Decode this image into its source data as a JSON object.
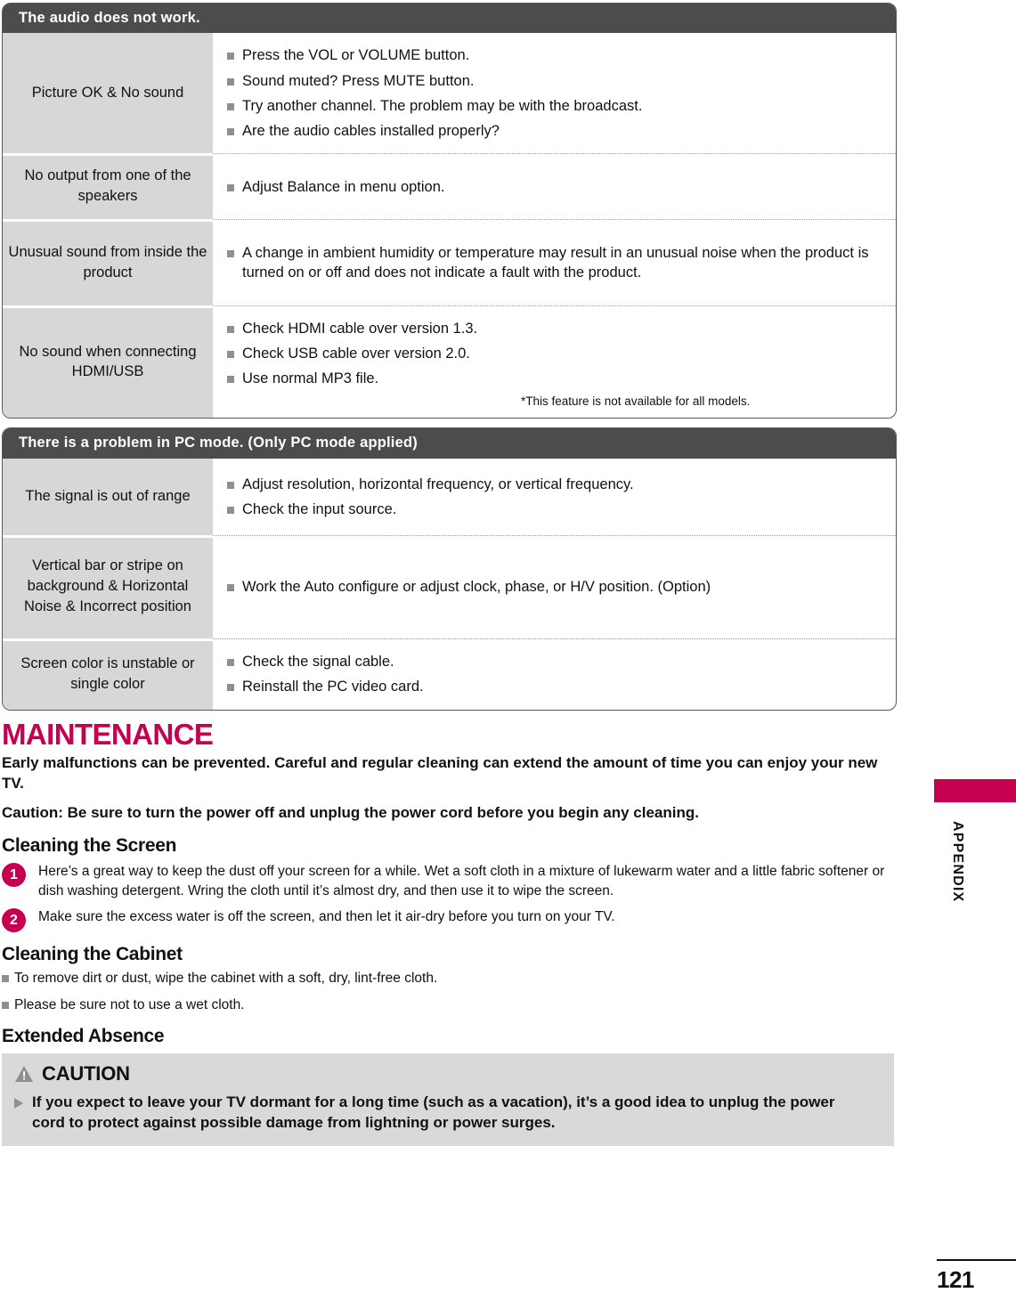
{
  "colors": {
    "accent": "#C6004F",
    "header_bar": "#4C4C4C",
    "label_cell": "#D7D7D7",
    "caution_bg": "#D9D9D9",
    "bullet": "#8F8F8F"
  },
  "tables": [
    {
      "header": "The audio does not work.",
      "rows": [
        {
          "label": "Picture OK & No sound",
          "items": [
            "Press the VOL or VOLUME button.",
            "Sound muted? Press MUTE button.",
            "Try another channel. The problem may be with the broadcast.",
            "Are the audio cables installed properly?"
          ]
        },
        {
          "label": "No output from one of the speakers",
          "items": [
            "Adjust Balance in menu option."
          ]
        },
        {
          "label": "Unusual sound from inside the product",
          "items": [
            "A change in ambient humidity or temperature may result in an unusual noise when the product is turned on or off and does not indicate a fault with the product."
          ]
        },
        {
          "label": "No sound when connecting HDMI/USB",
          "items": [
            "Check HDMI cable over version 1.3.",
            "Check USB cable over version 2.0.",
            "Use normal MP3 file."
          ],
          "note": "*This feature is not available for all models."
        }
      ]
    },
    {
      "header": "There is a problem in PC mode. (Only PC mode applied)",
      "rows": [
        {
          "label": "The signal is out of range",
          "items": [
            "Adjust resolution, horizontal frequency, or vertical frequency.",
            "Check the input source."
          ]
        },
        {
          "label": "Vertical bar or stripe on background & Horizontal Noise & Incorrect position",
          "items": [
            "Work the Auto configure or adjust clock, phase, or H/V position. (Option)"
          ]
        },
        {
          "label": "Screen color is unstable or single color",
          "items": [
            "Check the signal cable.",
            "Reinstall the PC video card."
          ]
        }
      ]
    }
  ],
  "maintenance": {
    "title": "MAINTENANCE",
    "intro": "Early malfunctions can be prevented. Careful and regular cleaning can extend the amount of time you can enjoy your new TV.",
    "caution_line": "Caution: Be sure to turn the power off and unplug the power cord before you begin any cleaning.",
    "cleaning_screen": {
      "title": "Cleaning the Screen",
      "steps": [
        {
          "num": "1",
          "text": "Here’s a great way to keep the dust off your screen for a while. Wet a soft cloth in a mixture of lukewarm water and a little fabric softener or dish washing detergent. Wring the cloth until it’s almost dry, and then use it to wipe the screen."
        },
        {
          "num": "2",
          "text": "Make sure the excess water is off the screen, and then let it air-dry before you turn on your TV."
        }
      ]
    },
    "cleaning_cabinet": {
      "title": "Cleaning the Cabinet",
      "items": [
        "To remove dirt or dust, wipe the cabinet with a soft, dry, lint-free cloth.",
        "Please be sure not to use a wet cloth."
      ]
    },
    "extended_absence": {
      "title": "Extended Absence",
      "caution_label": "CAUTION",
      "caution_text": "If you expect to leave your TV dormant for a long time (such as a vacation), it’s a good idea to unplug the power cord to protect against possible damage from lightning or power surges."
    }
  },
  "sidebar": {
    "tab_label": "APPENDIX",
    "page_number": "121"
  }
}
